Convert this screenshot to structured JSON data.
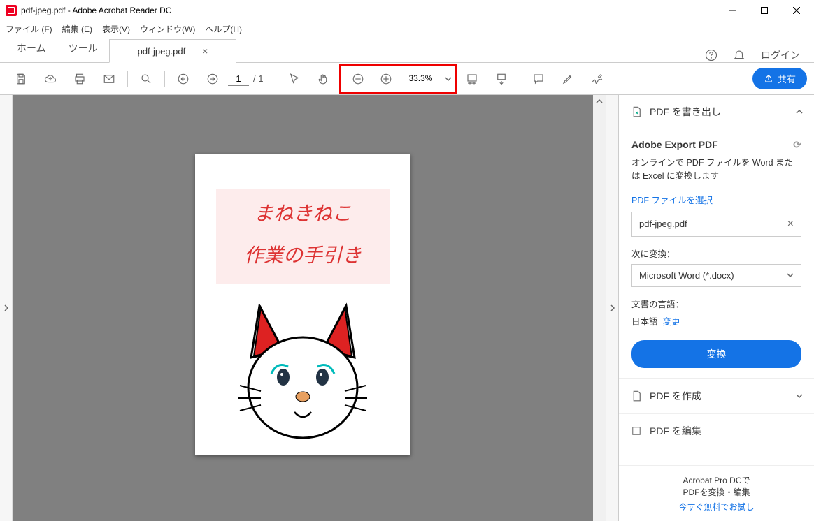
{
  "window": {
    "title": "pdf-jpeg.pdf - Adobe Acrobat Reader DC"
  },
  "menu": {
    "file": "ファイル (F)",
    "edit": "編集 (E)",
    "view": "表示(V)",
    "window": "ウィンドウ(W)",
    "help": "ヘルプ(H)"
  },
  "tabs": {
    "home": "ホーム",
    "tools": "ツール",
    "doc": "pdf-jpeg.pdf",
    "login": "ログイン"
  },
  "toolbar": {
    "page_current": "1",
    "page_total": "/ 1",
    "zoom_value": "33.3%",
    "share": "共有"
  },
  "document": {
    "banner_line1": "まねきねこ",
    "banner_line2": "作業の手引き"
  },
  "sidebar": {
    "export_head": "PDF を書き出し",
    "export_title": "Adobe Export PDF",
    "export_desc": "オンラインで PDF ファイルを Word または Excel に変換します",
    "select_file_link": "PDF ファイルを選択",
    "selected_file": "pdf-jpeg.pdf",
    "convert_to_label": "次に変換：",
    "convert_format": "Microsoft Word (*.docx)",
    "doc_lang_label": "文書の言語：",
    "doc_lang_value": "日本語",
    "change_link": "変更",
    "convert_btn": "変換",
    "create_head": "PDF を作成",
    "edit_head": "PDF を編集",
    "footer_line1": "Acrobat Pro DCで",
    "footer_line2": "PDFを変換・編集",
    "footer_try": "今すぐ無料でお試し"
  }
}
